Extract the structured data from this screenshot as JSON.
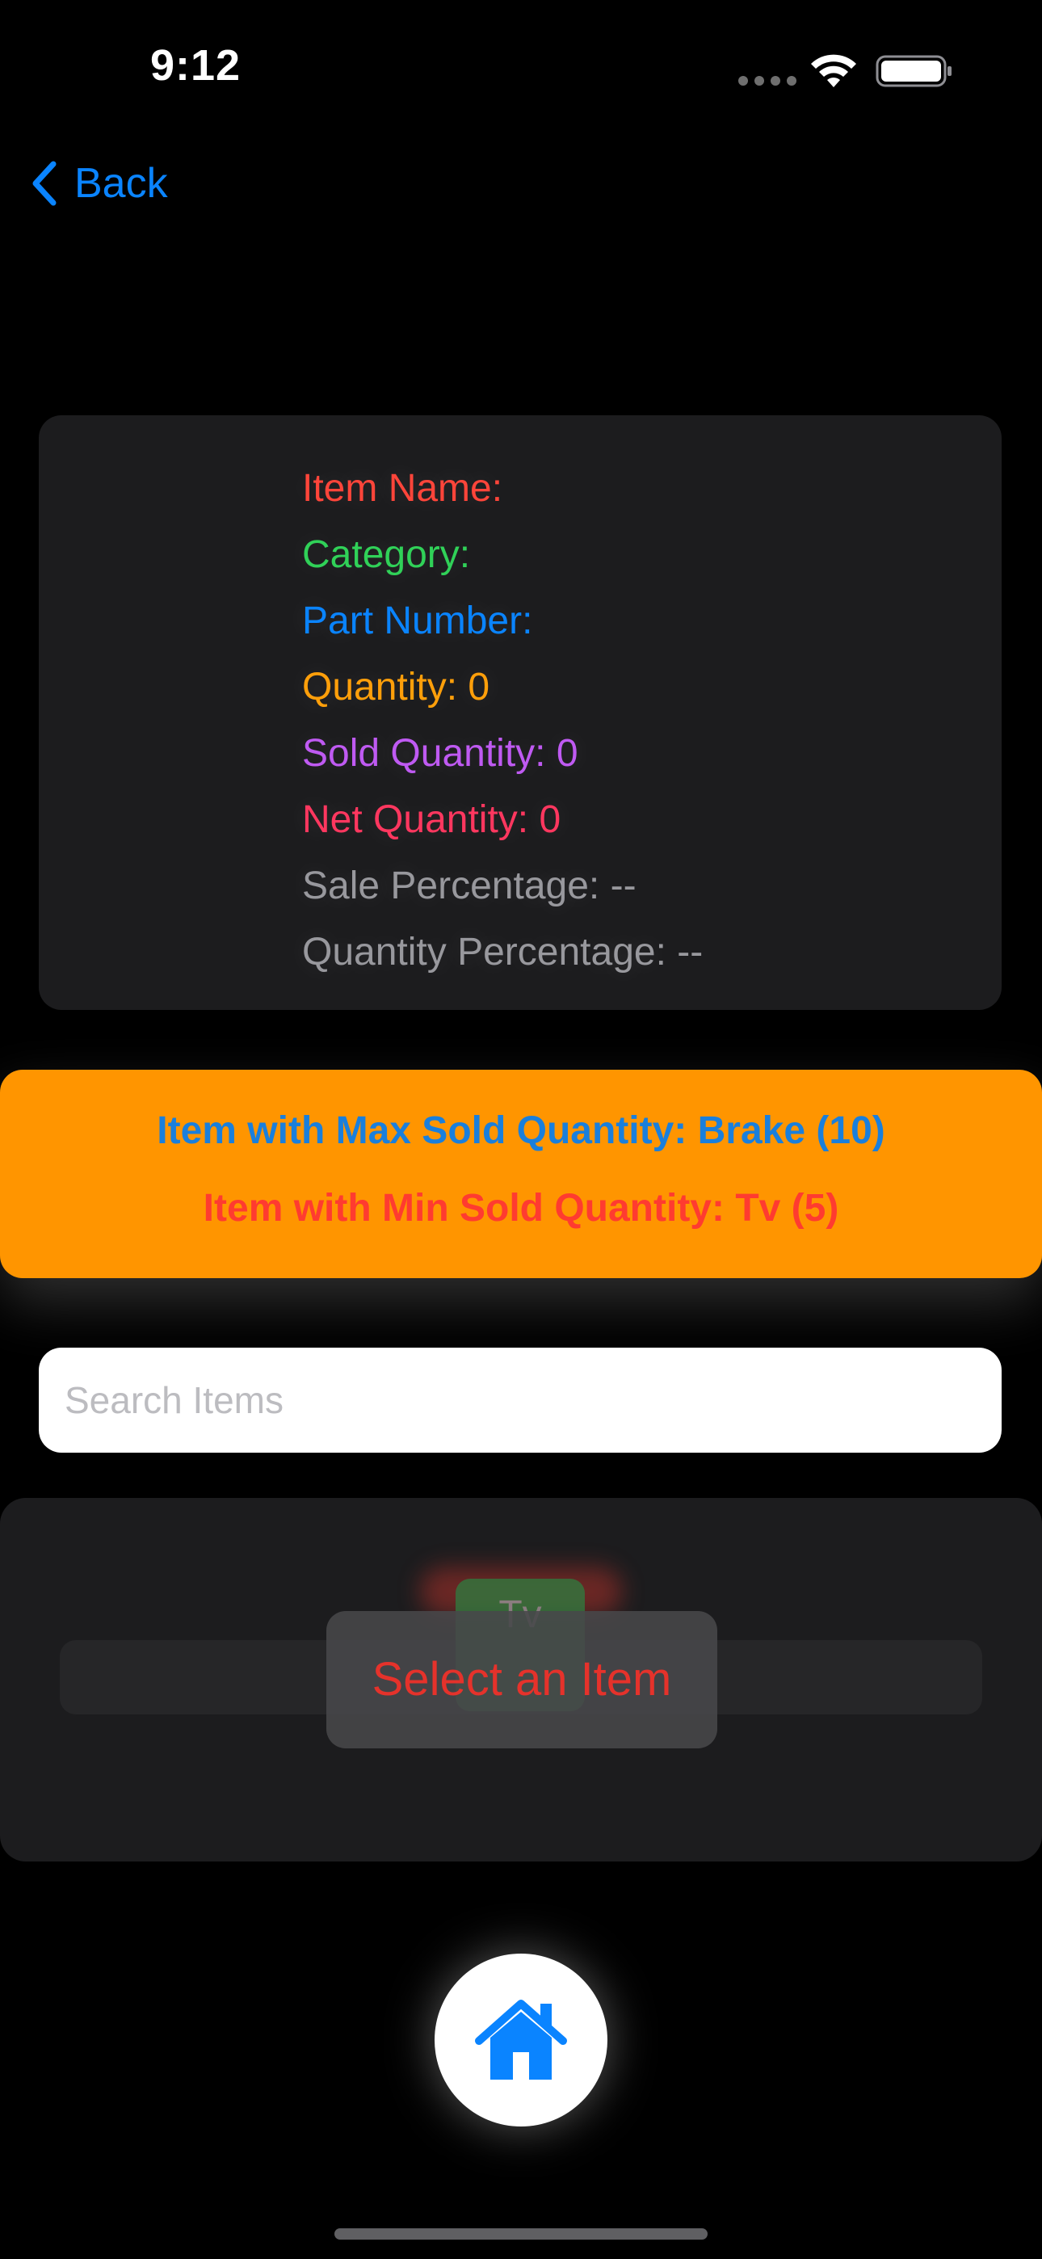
{
  "status_bar": {
    "time": "9:12"
  },
  "nav": {
    "back_label": "Back"
  },
  "info": {
    "lines": [
      {
        "text": "Item Name:",
        "color": "#ff453a"
      },
      {
        "text": "Category:",
        "color": "#30d158"
      },
      {
        "text": "Part Number:",
        "color": "#0a84ff"
      },
      {
        "text": "Quantity: 0",
        "color": "#ff9f0a"
      },
      {
        "text": "Sold Quantity: 0",
        "color": "#bf5af2"
      },
      {
        "text": "Net Quantity: 0",
        "color": "#ff375f"
      },
      {
        "text": "Sale Percentage: --",
        "color": "#98989d"
      },
      {
        "text": "Quantity Percentage: --",
        "color": "#98989d"
      }
    ]
  },
  "banner": {
    "max_line": "Item with Max Sold Quantity: Brake (10)",
    "min_line": "Item with Min Sold Quantity: Tv (5)",
    "background": "#ff9500",
    "max_color": "#1a7fdc",
    "min_color": "#ff3b30"
  },
  "search": {
    "placeholder": "Search Items",
    "value": ""
  },
  "picker": {
    "option": "Tv",
    "selected_label": "Select an Item"
  },
  "icons": {
    "back": "chevron-left-icon",
    "wifi": "wifi-icon",
    "battery": "battery-icon",
    "home": "house-icon"
  },
  "colors": {
    "accent": "#0a84ff",
    "card_background": "#1c1c1e"
  }
}
